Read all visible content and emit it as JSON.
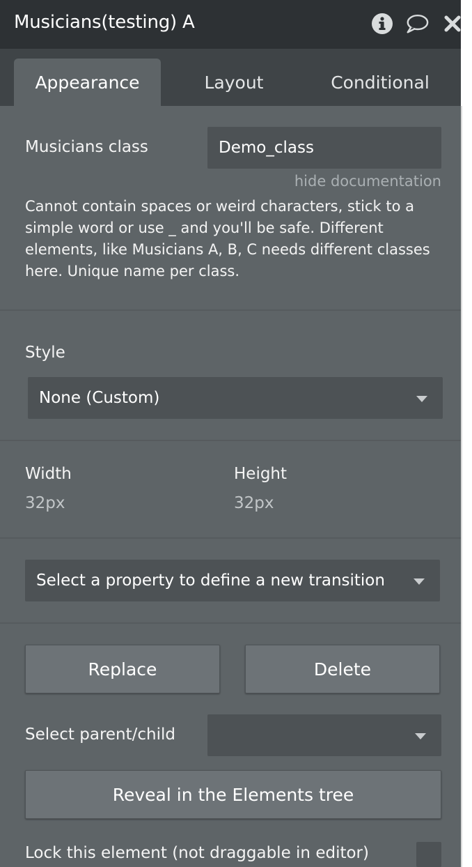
{
  "header": {
    "title": "Musicians(testing) A",
    "icons": [
      "info-icon",
      "comment-icon",
      "close-icon"
    ]
  },
  "tabs": [
    {
      "label": "Appearance",
      "active": true
    },
    {
      "label": "Layout",
      "active": false
    },
    {
      "label": "Conditional",
      "active": false
    }
  ],
  "class_field": {
    "label": "Musicians class",
    "value": "Demo_class",
    "doc_toggle": "hide documentation",
    "documentation": "Cannot contain spaces or weird characters, stick to a simple word or use _ and you'll be safe. Different elements, like Musicians A, B, C needs different classes here. Unique name per class."
  },
  "style": {
    "label": "Style",
    "selected": "None (Custom)"
  },
  "dimensions": {
    "width_label": "Width",
    "width_value": "32px",
    "height_label": "Height",
    "height_value": "32px"
  },
  "transition": {
    "selected": "Select a property to define a new transition"
  },
  "actions": {
    "replace_label": "Replace",
    "delete_label": "Delete",
    "parent_child_label": "Select parent/child",
    "parent_child_value": "",
    "reveal_label": "Reveal in the Elements tree",
    "lock_label": "Lock this element (not draggable in editor)"
  },
  "colors": {
    "panel_bg": "#5e6467",
    "header_bg": "#2d3134",
    "tabbar_bg": "#3f4447",
    "input_bg": "#4d5255",
    "button_bg": "#6d7377"
  }
}
